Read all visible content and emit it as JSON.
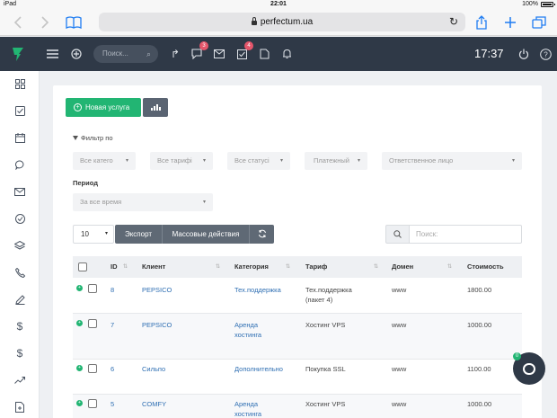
{
  "status_bar": {
    "device": "iPad",
    "time": "22:01",
    "battery": "100%"
  },
  "browser": {
    "url": "perfectum.ua"
  },
  "topbar": {
    "search_placeholder": "Поиск...",
    "badges": {
      "chat": "3",
      "tasks": "4"
    },
    "clock": "17:37"
  },
  "toolbar": {
    "new_service_label": "Новая услуга"
  },
  "filters": {
    "title": "Фильтр по",
    "category": "Все катего",
    "tariff": "Все тарифі",
    "status": "Все статусі",
    "paid": "Платежный",
    "responsible": "Ответственное лицо",
    "period_label": "Период",
    "period_value": "За все время"
  },
  "table_controls": {
    "page_size": "10",
    "export_label": "Экспорт",
    "bulk_label": "Массовые действия",
    "search_placeholder": "Поиск:"
  },
  "table": {
    "columns": [
      "ID",
      "Клиент",
      "Категория",
      "Тариф",
      "Домен",
      "Стоимость"
    ],
    "rows": [
      {
        "id": "8",
        "client": "PEPSICO",
        "category_1": "Тех.поддержка",
        "category_2": "",
        "tariff_1": "Тех.поддержка",
        "tariff_2": "(пакет 4)",
        "domain": "www",
        "price": "1800.00"
      },
      {
        "id": "7",
        "client": "PEPSICO",
        "category_1": "Аренда",
        "category_2": "хостинга",
        "tariff_1": "Хостинг VPS",
        "tariff_2": "",
        "domain": "www",
        "price": "1000.00"
      },
      {
        "id": "6",
        "client": "Сильпо",
        "category_1": "Дополнительно",
        "category_2": "",
        "tariff_1": "Покупка SSL",
        "tariff_2": "",
        "domain": "www",
        "price": "1100.00"
      },
      {
        "id": "5",
        "client": "COMFY",
        "category_1": "Аренда",
        "category_2": "хостинга",
        "tariff_1": "Хостинг VPS",
        "tariff_2": "",
        "domain": "www",
        "price": "1000.00"
      }
    ]
  },
  "chat_widget": {
    "badge": "0"
  },
  "colors": {
    "topbar": "#2f3947",
    "accent_green": "#22b573",
    "link_blue": "#2f6fb3"
  }
}
